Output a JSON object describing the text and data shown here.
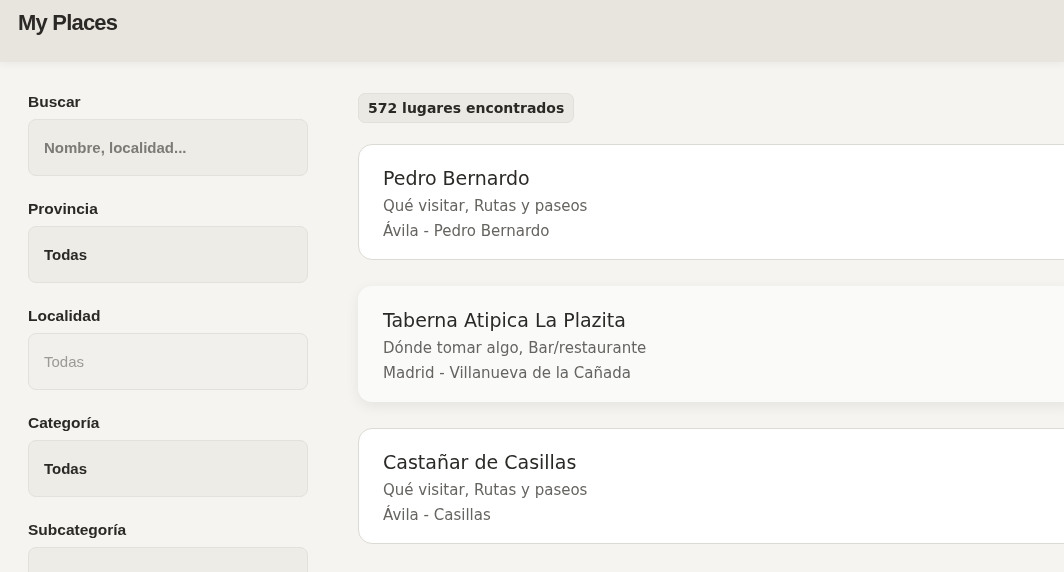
{
  "header": {
    "title": "My Places"
  },
  "filters": [
    {
      "label": "Buscar",
      "kind": "input",
      "placeholder": "Nombre, localidad..."
    },
    {
      "label": "Provincia",
      "kind": "select",
      "value": "Todas",
      "disabled": false
    },
    {
      "label": "Localidad",
      "kind": "select",
      "value": "Todas",
      "disabled": true
    },
    {
      "label": "Categoría",
      "kind": "select",
      "value": "Todas",
      "disabled": false
    },
    {
      "label": "Subcategoría",
      "kind": "select"
    }
  ],
  "results": {
    "count": "572 lugares encontrados",
    "places": [
      {
        "name": "Pedro Bernardo",
        "categories": "Qué visitar, Rutas y paseos",
        "location": "Ávila - Pedro Bernardo",
        "highlighted": false
      },
      {
        "name": "Taberna Atipica La Plazita",
        "categories": "Dónde tomar algo, Bar/restaurante",
        "location": "Madrid - Villanueva de la Cañada",
        "highlighted": true
      },
      {
        "name": "Castañar de Casillas",
        "categories": "Qué visitar, Rutas y paseos",
        "location": "Ávila - Casillas",
        "highlighted": false
      }
    ]
  }
}
